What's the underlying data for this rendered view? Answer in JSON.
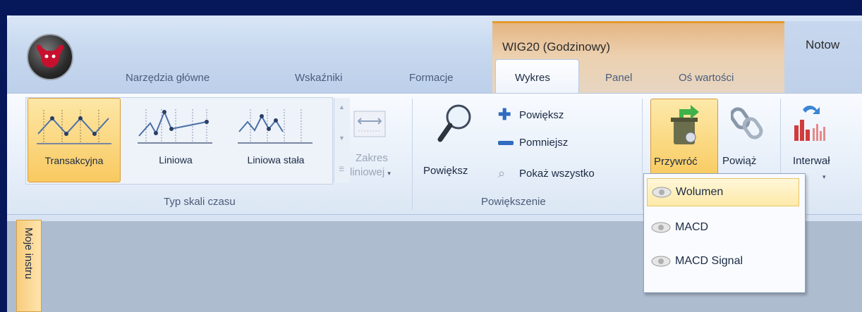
{
  "context": {
    "title": "WIG20 (Godzinowy)",
    "next_title": "Notow"
  },
  "tabs": [
    {
      "label": "Narzędzia główne"
    },
    {
      "label": "Wskaźniki"
    },
    {
      "label": "Formacje"
    },
    {
      "label": "Wykres",
      "active": true
    },
    {
      "label": "Panel"
    },
    {
      "label": "Oś wartości"
    }
  ],
  "groups": {
    "typ_skali": {
      "label": "Typ skali czasu",
      "items": [
        {
          "label": "Transakcyjna",
          "selected": true
        },
        {
          "label": "Liniowa"
        },
        {
          "label": "Liniowa stała"
        }
      ],
      "zakres": {
        "line1": "Zakres",
        "line2": "liniowej",
        "arrow": "▾"
      }
    },
    "powiekszenie": {
      "label": "Powiększenie",
      "big": "Powiększ",
      "zoom_in": "Powiększ",
      "zoom_out": "Pomniejsz",
      "show_all": "Pokaż wszystko"
    },
    "other": {
      "przywroc": "Przywróć",
      "powiaz": "Powiąż",
      "interwal": "Interwał",
      "arrow": "▾"
    }
  },
  "dropdown": {
    "items": [
      {
        "label": "Wolumen",
        "hover": true
      },
      {
        "label": "MACD"
      },
      {
        "label": "MACD Signal"
      }
    ]
  },
  "side_tab": {
    "label": "Moje instru"
  },
  "colors": {
    "accent": "#f8c756",
    "frame": "#06185a",
    "ribbon": "#e7eff9"
  }
}
